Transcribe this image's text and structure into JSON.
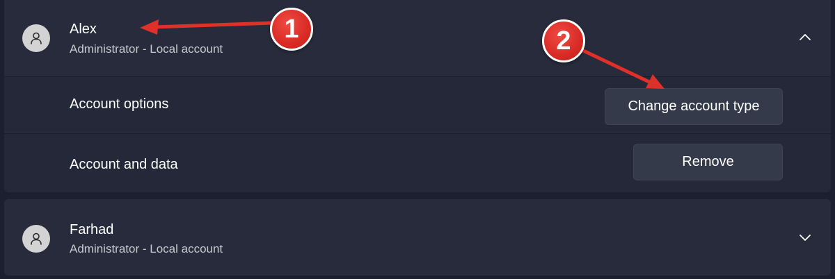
{
  "accounts": [
    {
      "name": "Alex",
      "subtitle": "Administrator - Local account",
      "expanded": true,
      "chevron_icon": "chevron-up-icon",
      "options": [
        {
          "label": "Account options",
          "button_label": "Change account type"
        },
        {
          "label": "Account and data",
          "button_label": "Remove"
        }
      ]
    },
    {
      "name": "Farhad",
      "subtitle": "Administrator - Local account",
      "expanded": false,
      "chevron_icon": "chevron-down-icon"
    }
  ],
  "annotations": [
    {
      "number": "1",
      "color": "#d92b25"
    },
    {
      "number": "2",
      "color": "#d92b25"
    }
  ],
  "colors": {
    "background": "#1b1f2e",
    "card": "#272b3b",
    "button": "#353a4b",
    "annotation_red": "#d92b25"
  }
}
